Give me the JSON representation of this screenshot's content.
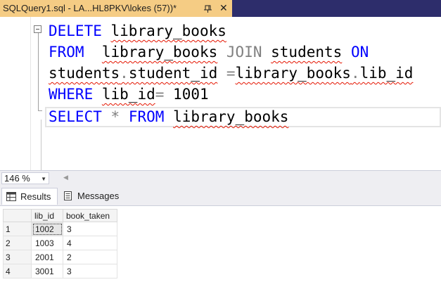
{
  "tab": {
    "title": "SQLQuery1.sql - LA...HL8PKV\\lokes (57))*",
    "pin_icon": "pin-icon",
    "close_icon": "close-icon",
    "close_glyph": "✕"
  },
  "editor": {
    "lines": [
      {
        "t1": "DELETE",
        "t2": "library_books"
      },
      {
        "t1": "FROM",
        "t2": "library_books",
        "t3": "JOIN",
        "t4": "students",
        "t5": "ON"
      },
      {
        "t1": "students",
        "t2": ".",
        "t3": "student_id",
        "t4": "=",
        "t5": "library_books",
        "t6": ".",
        "t7": "lib_id"
      },
      {
        "t1": "WHERE",
        "t2": "lib_id",
        "t3": "=",
        "t4": "1001"
      },
      {
        "t1": "SELECT",
        "t2": "*",
        "t3": "FROM",
        "t4": "library_books"
      }
    ]
  },
  "zoom": {
    "value": "146 %"
  },
  "results_tabs": [
    {
      "label": "Results",
      "icon": "grid-icon"
    },
    {
      "label": "Messages",
      "icon": "messages-icon"
    }
  ],
  "grid": {
    "columns": [
      "lib_id",
      "book_taken"
    ],
    "rows": [
      {
        "num": "1",
        "lib_id": "1002",
        "book_taken": "3"
      },
      {
        "num": "2",
        "lib_id": "1003",
        "book_taken": "4"
      },
      {
        "num": "3",
        "lib_id": "2001",
        "book_taken": "2"
      },
      {
        "num": "4",
        "lib_id": "3001",
        "book_taken": "3"
      }
    ]
  },
  "colors": {
    "tab_active": "#f5cc84",
    "tab_strip": "#2d2d6b",
    "keyword": "#0000ff",
    "operator": "#808080",
    "squiggle": "#e51400"
  }
}
